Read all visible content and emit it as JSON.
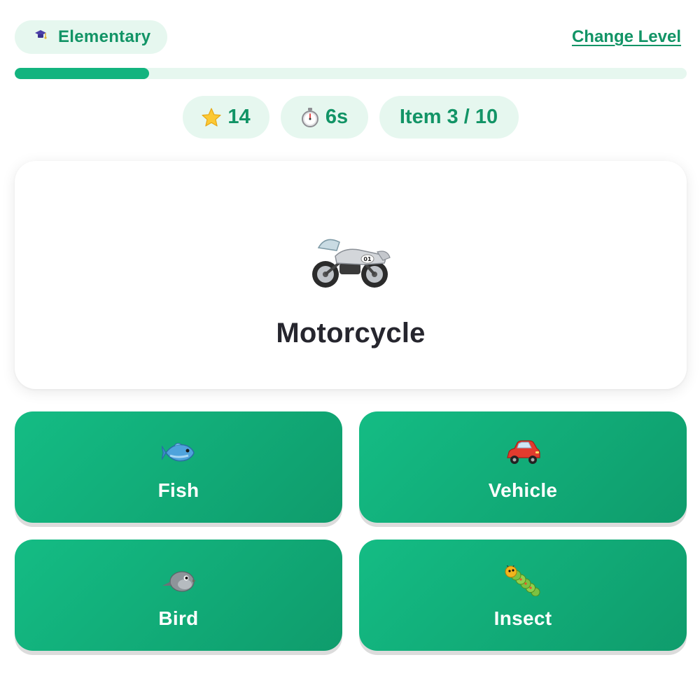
{
  "header": {
    "level_label": "Elementary",
    "level_icon": "graduation-cap-icon",
    "change_level_label": "Change Level"
  },
  "progress": {
    "fraction": 0.2
  },
  "stats": {
    "stars": "14",
    "stars_icon": "star-icon",
    "timer": "6s",
    "timer_icon": "stopwatch-icon",
    "item": "Item 3 / 10"
  },
  "card": {
    "icon": "motorcycle-icon",
    "word": "Motorcycle"
  },
  "answers": [
    {
      "label": "Fish",
      "icon": "fish-icon"
    },
    {
      "label": "Vehicle",
      "icon": "car-icon"
    },
    {
      "label": "Bird",
      "icon": "bird-icon"
    },
    {
      "label": "Insect",
      "icon": "caterpillar-icon"
    }
  ],
  "colors": {
    "accent": "#129466",
    "pill_bg": "#e6f7ef",
    "button_green": "#13b47f",
    "text_dark": "#26262e"
  }
}
